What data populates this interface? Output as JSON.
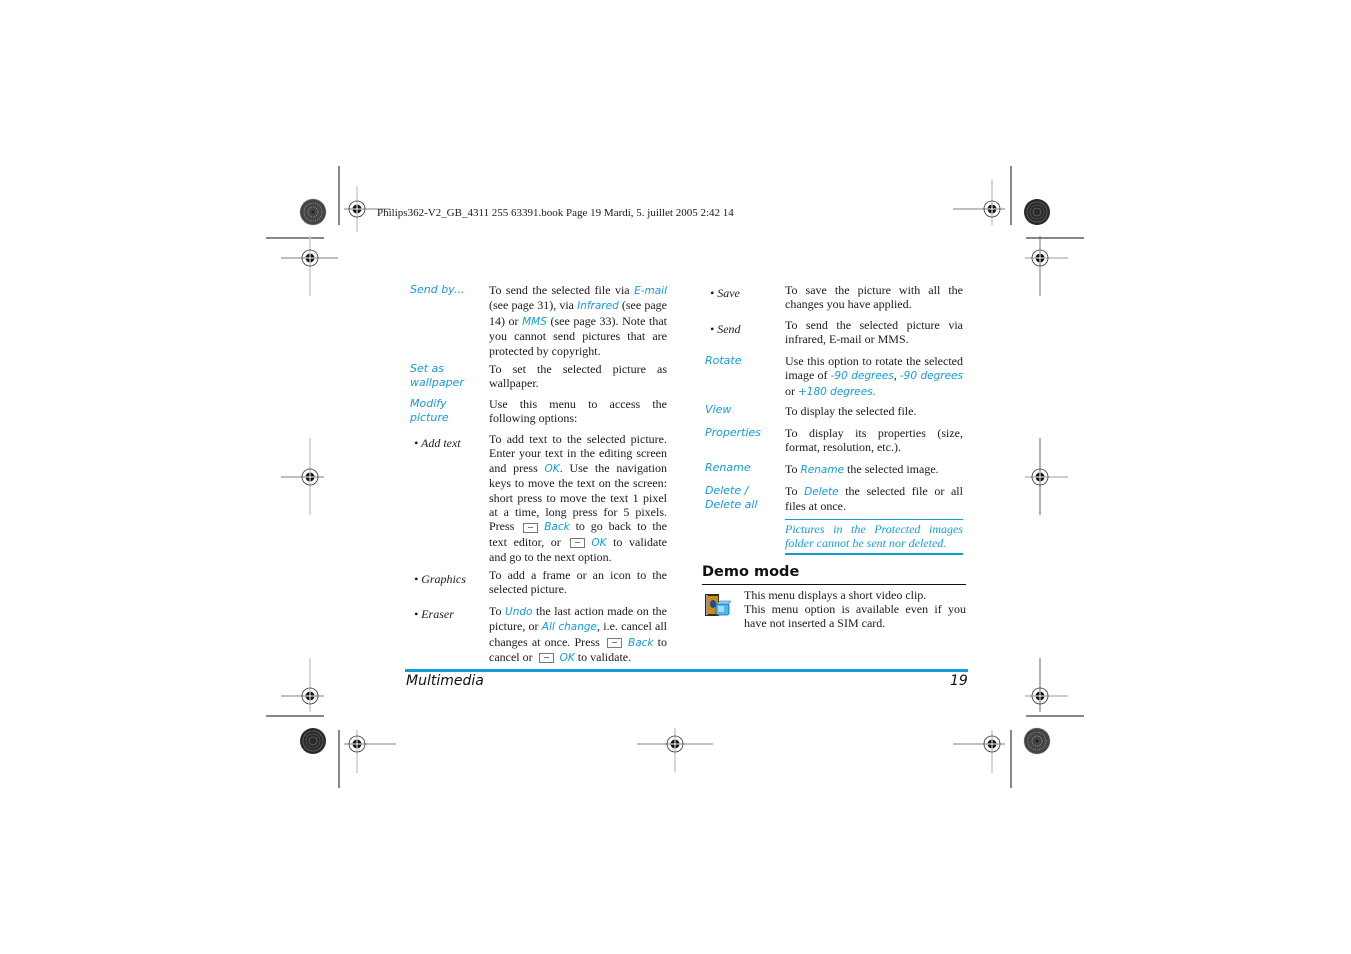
{
  "header": {
    "print_info": "Philips362-V2_GB_4311 255 63391.book  Page 19  Mardi, 5. juillet 2005  2:42 14"
  },
  "left_column": {
    "send_by": {
      "term": "Send by...",
      "desc": [
        {
          "t": "To send the selected file via "
        },
        {
          "t": "E-mail",
          "link": true
        },
        {
          "t": " (see page 31), via "
        },
        {
          "t": "Infrared",
          "link": true
        },
        {
          "t": " (see page 14) or "
        },
        {
          "t": "MMS",
          "link": true
        },
        {
          "t": " (see page 33). Note that you cannot send pictures that are protected by copyright."
        }
      ]
    },
    "set_as_wallpaper": {
      "term_line1": "Set as",
      "term_line2": "wallpaper",
      "desc": "To set the selected picture as wallpaper."
    },
    "modify_picture": {
      "term_line1": "Modify",
      "term_line2": "picture",
      "desc": "Use this menu to access the following options:"
    },
    "add_text": {
      "term": "• Add text",
      "desc": [
        {
          "t": "To add text to the selected picture. Enter your text in the editing screen and press "
        },
        {
          "t": "OK",
          "link": true
        },
        {
          "t": ". Use the navigation keys to move the text on the screen: short press to move the text 1 pixel at a time, long press for 5 pixels. Press "
        },
        {
          "key": "left-softkey"
        },
        {
          "t": "Back",
          "link": true
        },
        {
          "t": " to go back to the text editor, or "
        },
        {
          "key": "right-softkey"
        },
        {
          "t": "OK",
          "link": true
        },
        {
          "t": " to validate and go to the next option."
        }
      ]
    },
    "graphics": {
      "term": "• Graphics",
      "desc": "To add a frame or an icon to the selected picture."
    },
    "eraser": {
      "term": "• Eraser",
      "desc": [
        {
          "t": "To "
        },
        {
          "t": "Undo",
          "link": true
        },
        {
          "t": " the last action made on the picture, or "
        },
        {
          "t": "All change",
          "link": true
        },
        {
          "t": ", i.e. cancel all changes at once. Press "
        },
        {
          "key": "left-softkey"
        },
        {
          "t": "Back",
          "link": true
        },
        {
          "t": " to cancel or "
        },
        {
          "key": "right-softkey"
        },
        {
          "t": "OK",
          "link": true
        },
        {
          "t": " to validate."
        }
      ]
    }
  },
  "right_column": {
    "save": {
      "term": "• Save",
      "desc": "To save the picture with all the changes you have applied."
    },
    "send": {
      "term": "• Send",
      "desc": "To send the selected picture via infrared, E-mail or MMS."
    },
    "rotate": {
      "term": "Rotate",
      "desc": [
        {
          "t": "Use this option to rotate the selected image of "
        },
        {
          "t": "-90 degrees",
          "link": true
        },
        {
          "t": ", "
        },
        {
          "t": "-90 degrees",
          "link": true
        },
        {
          "t": " or "
        },
        {
          "t": "+180 degrees.",
          "link": true
        }
      ]
    },
    "view": {
      "term": "View",
      "desc": "To display the selected file."
    },
    "properties": {
      "term": "Properties",
      "desc": "To display its properties (size, format, resolution, etc.)."
    },
    "rename": {
      "term": "Rename",
      "desc": [
        {
          "t": "To "
        },
        {
          "t": "Rename",
          "link": true
        },
        {
          "t": " the selected image."
        }
      ]
    },
    "delete": {
      "term_line1": "Delete /",
      "term_line2": "Delete all",
      "desc": [
        {
          "t": "To "
        },
        {
          "t": "Delete",
          "link": true
        },
        {
          "t": " the selected file or all files at once."
        }
      ]
    },
    "note": "Pictures in the Protected images folder cannot be sent nor deleted."
  },
  "demo_mode": {
    "title": "Demo mode",
    "icon": "video-clip-icon",
    "line1": "This menu displays a short video clip.",
    "line2": "This menu option is available even if you have not inserted a SIM card."
  },
  "footer": {
    "section": "Multimedia",
    "page_number": "19"
  },
  "colors": {
    "accent": "#159ad8",
    "text": "#1a1a1a"
  }
}
